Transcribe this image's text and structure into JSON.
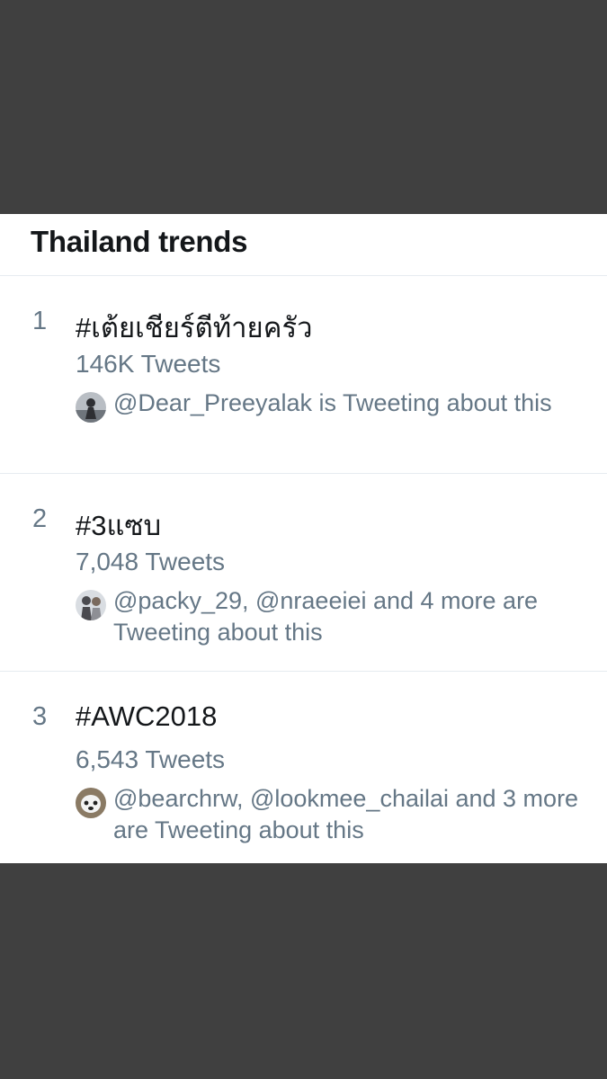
{
  "header": {
    "title": "Thailand trends"
  },
  "trends": [
    {
      "rank": "1",
      "tag": "#เต้ยเชียร์ตีท้ายครัว",
      "count": "146K Tweets",
      "context": "@Dear_Preeyalak is Tweeting about this"
    },
    {
      "rank": "2",
      "tag": "#3แซบ",
      "count": "7,048 Tweets",
      "context": "@packy_29, @nraeeiei and 4 more are Tweeting about this"
    },
    {
      "rank": "3",
      "tag": "#AWC2018",
      "count": "6,543 Tweets",
      "context": "@bearchrw, @lookmee_chailai and 3 more are Tweeting about this"
    }
  ],
  "colors": {
    "backdrop": "#404040",
    "panel": "#ffffff",
    "primary_text": "#14171a",
    "secondary_text": "#657786",
    "divider": "#e6ecf0"
  }
}
